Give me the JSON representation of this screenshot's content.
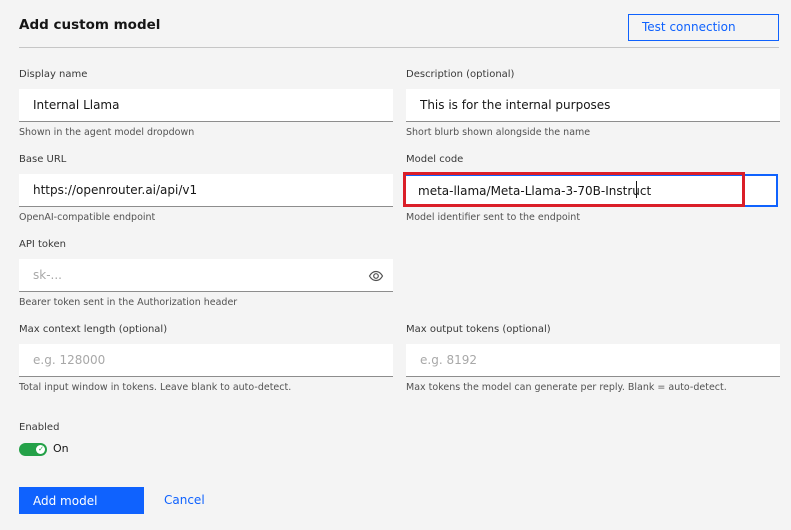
{
  "header": {
    "title": "Add custom model",
    "test_connection_label": "Test connection"
  },
  "fields": {
    "display_name": {
      "label": "Display name",
      "value": "Internal Llama",
      "helper": "Shown in the agent model dropdown"
    },
    "description": {
      "label": "Description (optional)",
      "value": "This is for the internal purposes",
      "helper": "Short blurb shown alongside the name"
    },
    "base_url": {
      "label": "Base URL",
      "value": "https://openrouter.ai/api/v1",
      "helper": "OpenAI-compatible endpoint"
    },
    "model_code": {
      "label": "Model code",
      "value": "meta-llama/Meta-Llama-3-70B-Instruct",
      "helper": "Model identifier sent to the endpoint"
    },
    "api_token": {
      "label": "API token",
      "placeholder": "sk-...",
      "helper": "Bearer token sent in the Authorization header",
      "icon": "eye-icon"
    },
    "max_context": {
      "label": "Max context length (optional)",
      "placeholder": "e.g. 128000",
      "helper": "Total input window in tokens. Leave blank to auto-detect."
    },
    "max_output": {
      "label": "Max output tokens (optional)",
      "placeholder": "e.g. 8192",
      "helper": "Max tokens the model can generate per reply. Blank = auto-detect."
    }
  },
  "enabled": {
    "label": "Enabled",
    "state_label": "On",
    "on": true
  },
  "actions": {
    "submit_label": "Add model",
    "cancel_label": "Cancel"
  },
  "colors": {
    "accent": "#0f62fe",
    "toggle_on": "#24a148",
    "highlight": "#da1e28"
  }
}
